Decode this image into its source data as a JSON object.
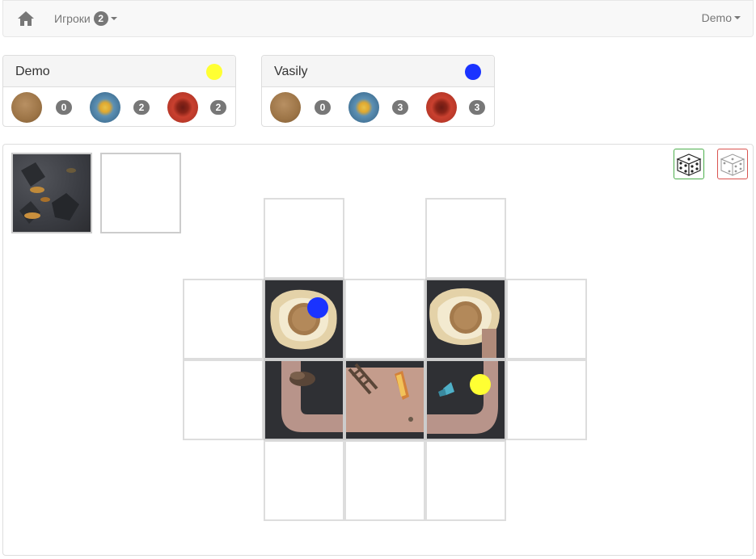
{
  "navbar": {
    "home_icon": "home-icon",
    "players_label": "Игроки",
    "players_count": "2",
    "user_label": "Demo"
  },
  "players": [
    {
      "name": "Demo",
      "color": "#ffff33",
      "tokens": [
        {
          "icon": "coin-token",
          "count": "0"
        },
        {
          "icon": "blue-crest-token",
          "count": "2"
        },
        {
          "icon": "red-bat-token",
          "count": "2"
        }
      ]
    },
    {
      "name": "Vasily",
      "color": "#1a33ff",
      "tokens": [
        {
          "icon": "coin-token",
          "count": "0"
        },
        {
          "icon": "blue-crest-token",
          "count": "3"
        },
        {
          "icon": "red-bat-token",
          "count": "3"
        }
      ]
    }
  ],
  "board": {
    "dice": [
      {
        "icon": "dice-icon",
        "color": "#4cae4c"
      },
      {
        "icon": "dice-icon",
        "color": "#d9534f"
      }
    ],
    "pawns": [
      {
        "player": "Vasily",
        "color": "#1a33ff"
      },
      {
        "player": "Demo",
        "color": "#ffff33"
      }
    ]
  }
}
